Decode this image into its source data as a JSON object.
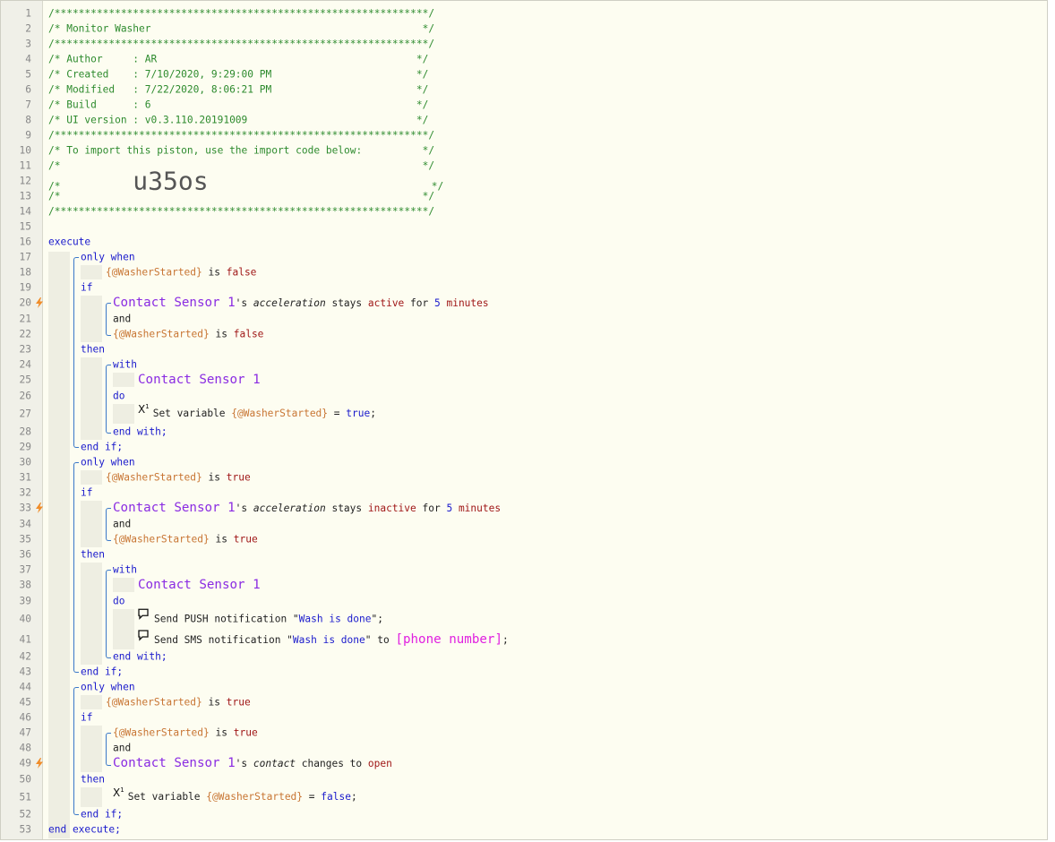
{
  "header": {
    "l1": "/**************************************************************/",
    "l2": "/* Monitor Washer                                             */",
    "l3": "/**************************************************************/",
    "l4": "/* Author     : AR                                           */",
    "l5": "/* Created    : 7/10/2020, 9:29:00 PM                        */",
    "l6": "/* Modified   : 7/22/2020, 8:06:21 PM                        */",
    "l7": "/* Build      : 6                                            */",
    "l8": "/* UI version : v0.3.110.20191009                            */",
    "l9": "/**************************************************************/",
    "l10": "/* To import this piston, use the import code below:          */",
    "l11": "/*                                                            */",
    "l12a": "/*            ",
    "l12code": "u35os",
    "l12b": "                                     */",
    "l13": "/*                                                            */",
    "l14": "/**************************************************************/"
  },
  "kw": {
    "execute": "execute",
    "only_when": "only when",
    "if": "if",
    "then": "then",
    "and": "and",
    "with": "with",
    "do": "do",
    "end_with": "end with;",
    "end_if": "end if;",
    "end_execute": "end execute;"
  },
  "tokens": {
    "var": "{@WasherStarted}",
    "is": " is ",
    "false": "false",
    "true": "true",
    "device": "Contact Sensor 1",
    "poss": "'s ",
    "acceleration": "acceleration",
    "contact": "contact",
    "stays": " stays ",
    "active": "active",
    "inactive": "inactive",
    "for": " for ",
    "five": "5",
    "minutes": " minutes",
    "changes_to": " changes to ",
    "open": "open",
    "set_variable": "Set variable ",
    "eq": " = ",
    "semi": ";",
    "send_push": "Send PUSH notification \"",
    "send_sms": "Send SMS notification \"",
    "wash_done": "Wash is done",
    "close_quote": "\";",
    "to": "\" to ",
    "phone": "[phone number]"
  },
  "line_numbers": [
    "1",
    "2",
    "3",
    "4",
    "5",
    "6",
    "7",
    "8",
    "9",
    "10",
    "11",
    "12",
    "13",
    "14",
    "15",
    "16",
    "17",
    "18",
    "19",
    "20",
    "21",
    "22",
    "23",
    "24",
    "25",
    "26",
    "27",
    "28",
    "29",
    "30",
    "31",
    "32",
    "33",
    "34",
    "35",
    "36",
    "37",
    "38",
    "39",
    "40",
    "41",
    "42",
    "43",
    "44",
    "45",
    "46",
    "47",
    "48",
    "49",
    "50",
    "51",
    "52",
    "53"
  ],
  "icons": {
    "trigger": "lightning-bolt-icon",
    "set_variable": "x-superscript-1-icon",
    "notification": "speech-bubble-icon"
  },
  "colors": {
    "comment": "#2e8b2e",
    "keyword": "#1a1acc",
    "variable": "#c87533",
    "value": "#a01818",
    "device": "#8a2be2",
    "phone": "#e020e0",
    "trigger": "#f08c28"
  }
}
